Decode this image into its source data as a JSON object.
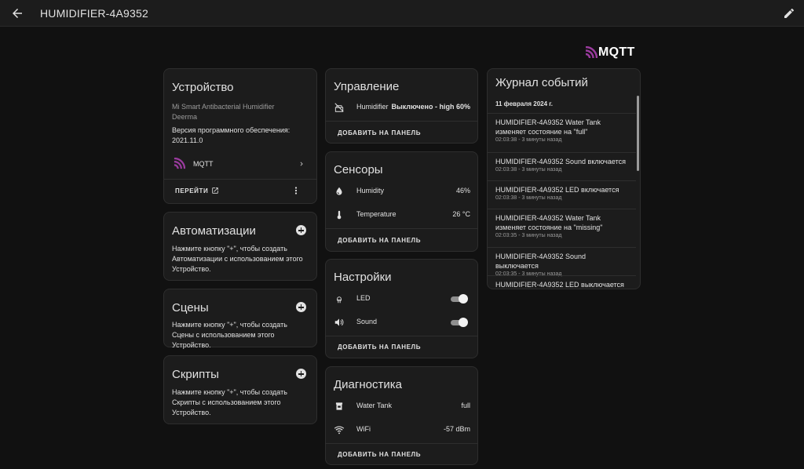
{
  "header": {
    "title": "HUMIDIFIER-4A9352"
  },
  "brand": {
    "logo_text": "MQTT",
    "logo_color": "#9a3b9e"
  },
  "device": {
    "title": "Устройство",
    "model": "Mi Smart Antibacterial Humidifier",
    "manufacturer": "Deerma",
    "firmware_label": "Версия программного обеспечения:",
    "firmware_version": "2021.11.0",
    "integration": "MQTT",
    "goto_label": "ПЕРЕЙТИ"
  },
  "automations": {
    "title": "Автоматизации",
    "description": "Нажмите кнопку \"+\", чтобы создать Автоматизации с использованием этого Устройство."
  },
  "scenes": {
    "title": "Сцены",
    "description": "Нажмите кнопку \"+\", чтобы создать Сцены с использованием этого Устройство."
  },
  "scripts": {
    "title": "Скрипты",
    "description": "Нажмите кнопку \"+\", чтобы создать Скрипты с использованием этого Устройство."
  },
  "add_to_panel": "ДОБАВИТЬ НА ПАНЕЛЬ",
  "controls": {
    "title": "Управление",
    "items": [
      {
        "icon": "humidifier-off-icon",
        "label": "Humidifier",
        "value": "Выключено - high 60%"
      }
    ]
  },
  "sensors": {
    "title": "Сенсоры",
    "items": [
      {
        "icon": "water-drop-icon",
        "label": "Humidity",
        "value": "46%"
      },
      {
        "icon": "thermometer-icon",
        "label": "Temperature",
        "value": "26 °C"
      }
    ]
  },
  "settings": {
    "title": "Настройки",
    "items": [
      {
        "icon": "led-icon",
        "label": "LED",
        "state": "on"
      },
      {
        "icon": "speaker-icon",
        "label": "Sound",
        "state": "on"
      }
    ]
  },
  "diagnostics": {
    "title": "Диагностика",
    "items": [
      {
        "icon": "water-tank-icon",
        "label": "Water Tank",
        "value": "full"
      },
      {
        "icon": "wifi-icon",
        "label": "WiFi",
        "value": "-57 dBm"
      }
    ]
  },
  "logbook": {
    "title": "Журнал событий",
    "date": "11 февраля 2024 г.",
    "entries": [
      {
        "message": "HUMIDIFIER-4A9352 Water Tank изменяет состояние на \"full\"",
        "time": "02:03:38 - 3 минуты назад"
      },
      {
        "message": "HUMIDIFIER-4A9352 Sound включается",
        "time": "02:03:38 - 3 минуты назад"
      },
      {
        "message": "HUMIDIFIER-4A9352 LED включается",
        "time": "02:03:38 - 3 минуты назад"
      },
      {
        "message": "HUMIDIFIER-4A9352 Water Tank изменяет состояние на \"missing\"",
        "time": "02:03:35 - 3 минуты назад"
      },
      {
        "message": "HUMIDIFIER-4A9352 Sound выключается",
        "time": "02:03:35 - 3 минуты назад"
      },
      {
        "message": "HUMIDIFIER-4A9352 LED выключается",
        "time": ""
      }
    ]
  }
}
